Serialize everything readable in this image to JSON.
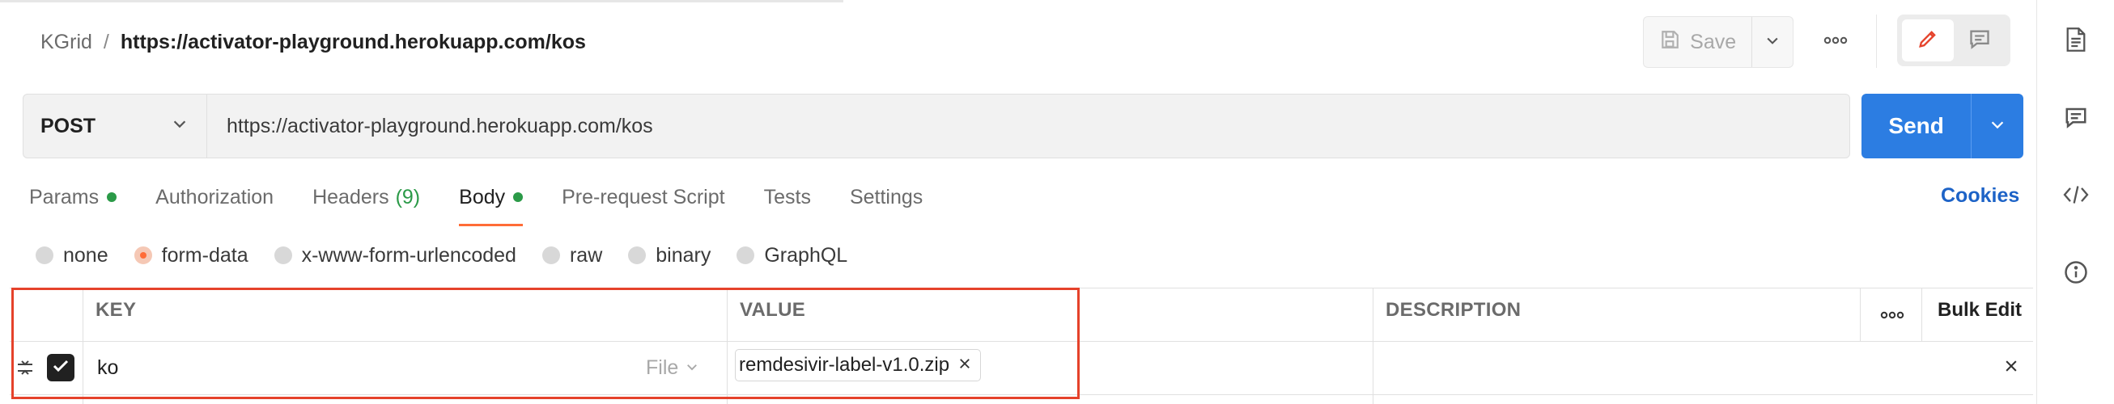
{
  "breadcrumb": {
    "parent": "KGrid",
    "separator": "/",
    "current": "https://activator-playground.herokuapp.com/kos"
  },
  "toolbar": {
    "save_label": "Save"
  },
  "request": {
    "method": "POST",
    "url": "https://activator-playground.herokuapp.com/kos",
    "send_label": "Send"
  },
  "tabs": [
    {
      "label": "Params",
      "dot": true
    },
    {
      "label": "Authorization"
    },
    {
      "label": "Headers",
      "count": "(9)"
    },
    {
      "label": "Body",
      "dot": true,
      "active": true
    },
    {
      "label": "Pre-request Script"
    },
    {
      "label": "Tests"
    },
    {
      "label": "Settings"
    }
  ],
  "cookies_label": "Cookies",
  "body_types": [
    {
      "label": "none"
    },
    {
      "label": "form-data",
      "selected": true
    },
    {
      "label": "x-www-form-urlencoded"
    },
    {
      "label": "raw"
    },
    {
      "label": "binary"
    },
    {
      "label": "GraphQL"
    }
  ],
  "table": {
    "headers": {
      "key": "KEY",
      "value": "VALUE",
      "description": "DESCRIPTION",
      "bulk_edit": "Bulk Edit"
    },
    "rows": [
      {
        "checked": true,
        "key": "ko",
        "type": "File",
        "value_file": "remdesivir-label-v1.0.zip",
        "description": ""
      }
    ]
  },
  "colors": {
    "accent": "#ff6c37",
    "send": "#2c7de2",
    "link": "#1d63c7",
    "status_dot": "#2b9a48",
    "highlight": "#e5422b"
  },
  "icons": [
    "save-icon",
    "chevron-down-icon",
    "more-horizontal-icon",
    "pencil-icon",
    "comment-icon",
    "document-icon",
    "code-icon",
    "info-icon",
    "drag-handle-icon",
    "checkmark-icon",
    "close-icon"
  ]
}
